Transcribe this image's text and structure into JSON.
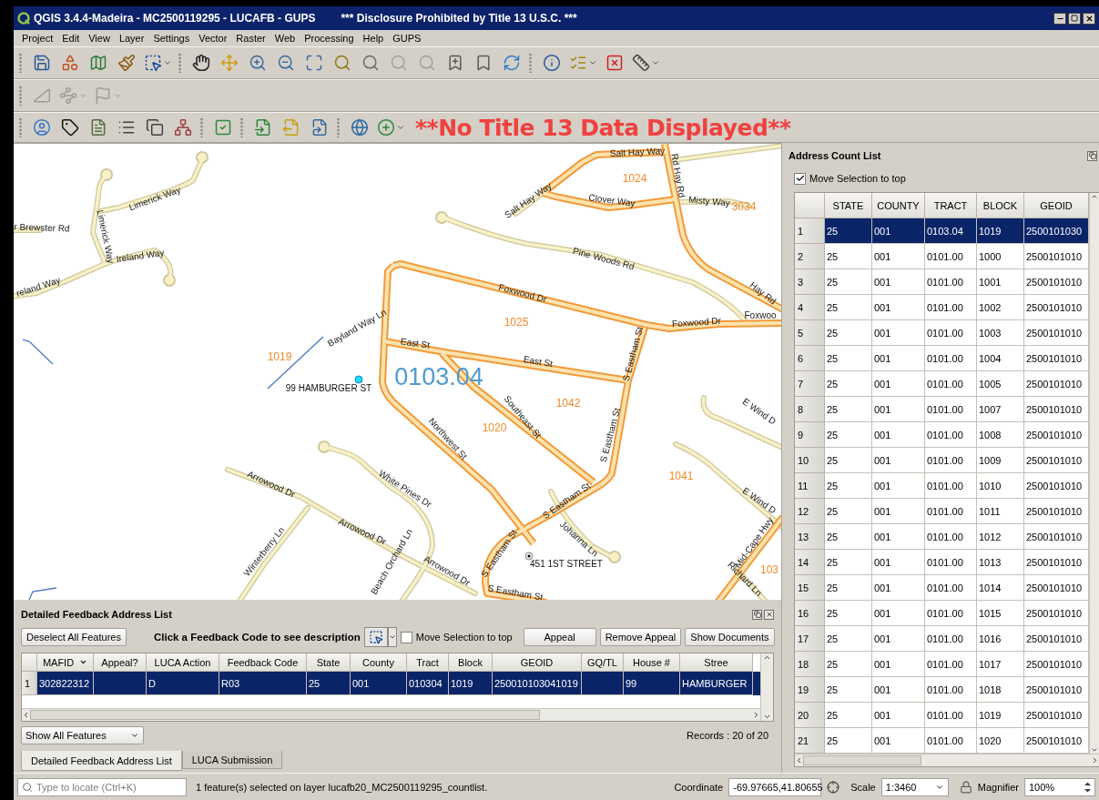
{
  "window": {
    "title": "QGIS 3.4.4-Madeira - MC2500119295 - LUCAFB - GUPS",
    "notice": "*** Disclosure Prohibited by Title 13 U.S.C. ***"
  },
  "menu": [
    "Project",
    "Edit",
    "View",
    "Layer",
    "Settings",
    "Vector",
    "Raster",
    "Web",
    "Processing",
    "Help",
    "GUPS"
  ],
  "banner": "**No Title 13 Data Displayed**",
  "map": {
    "labels": [
      {
        "kind": "street",
        "text": "Limerick Way"
      },
      {
        "kind": "street",
        "text": "Limerick Way"
      },
      {
        "kind": "street",
        "text": "r Brewster Rd"
      },
      {
        "kind": "street",
        "text": "Ireland Way"
      },
      {
        "kind": "street",
        "text": "reland Way"
      },
      {
        "kind": "block",
        "text": "1019"
      },
      {
        "kind": "street",
        "text": "Bayland Way Ln"
      },
      {
        "kind": "address",
        "text": "99 HAMBURGER ST"
      },
      {
        "kind": "tract",
        "text": "0103.04"
      },
      {
        "kind": "street",
        "text": "Salt Hay Way"
      },
      {
        "kind": "street",
        "text": "Rd Hay Rd"
      },
      {
        "kind": "block",
        "text": "1024"
      },
      {
        "kind": "street",
        "text": "Salt Hay Way"
      },
      {
        "kind": "street",
        "text": "Clover Way"
      },
      {
        "kind": "street",
        "text": "Misty Way"
      },
      {
        "kind": "block",
        "text": "3034"
      },
      {
        "kind": "street",
        "text": "Pine Woods Rd"
      },
      {
        "kind": "street",
        "text": "Hay Rd"
      },
      {
        "kind": "street",
        "text": "Foxwood Dr"
      },
      {
        "kind": "block",
        "text": "1025"
      },
      {
        "kind": "street",
        "text": "Foxwood Dr"
      },
      {
        "kind": "street",
        "text": "Foxwoo"
      },
      {
        "kind": "street",
        "text": "East St"
      },
      {
        "kind": "street",
        "text": "East St"
      },
      {
        "kind": "street",
        "text": "S Eastham St"
      },
      {
        "kind": "block",
        "text": "1042"
      },
      {
        "kind": "street",
        "text": "Southeast St"
      },
      {
        "kind": "block",
        "text": "1020"
      },
      {
        "kind": "street",
        "text": "Northwest St"
      },
      {
        "kind": "street",
        "text": "S Eastham St"
      },
      {
        "kind": "street",
        "text": "E Wind D"
      },
      {
        "kind": "block",
        "text": "1041"
      },
      {
        "kind": "street",
        "text": "E Wind D"
      },
      {
        "kind": "street",
        "text": "S Eastham St"
      },
      {
        "kind": "street",
        "text": "Johanna Ln"
      },
      {
        "kind": "address",
        "text": "451 1ST STREET"
      },
      {
        "kind": "street",
        "text": "S Eastham St"
      },
      {
        "kind": "street",
        "text": "S Eastham St"
      },
      {
        "kind": "street",
        "text": "Arrowood Dr"
      },
      {
        "kind": "street",
        "text": "Mid-Cape Hwy"
      },
      {
        "kind": "block",
        "text": "103"
      },
      {
        "kind": "street",
        "text": "Richard Ln"
      },
      {
        "kind": "street",
        "text": "Arrowood Dr"
      },
      {
        "kind": "street",
        "text": "Arrowood Dr"
      },
      {
        "kind": "street",
        "text": "Winterberry Ln"
      },
      {
        "kind": "street",
        "text": "White Pines Dr"
      },
      {
        "kind": "street",
        "text": "Beach Orchard Ln"
      }
    ]
  },
  "feedback_panel": {
    "title": "Detailed Feedback Address List",
    "deselect_button": "Deselect All Features",
    "hint": "Click a Feedback Code to see description",
    "move_selection": {
      "label": "Move Selection to top",
      "checked": false
    },
    "buttons": [
      "Appeal",
      "Remove Appeal",
      "Show Documents"
    ],
    "columns": [
      "MAFID",
      "Appeal?",
      "LUCA Action",
      "Feedback Code",
      "State",
      "County",
      "Tract",
      "Block",
      "GEOID",
      "GQ/TL",
      "House #",
      "Stree"
    ],
    "rows": [
      {
        "number": "1",
        "selected": true,
        "cells": [
          "302822312",
          null,
          "D",
          "R03",
          "25",
          "001",
          "010304",
          "1019",
          "250010103041019",
          null,
          "99",
          "HAMBURGER"
        ]
      }
    ],
    "filter": "Show All Features",
    "records": "Records : 20 of 20"
  },
  "dock_tabs": [
    {
      "label": "Detailed Feedback Address List",
      "selected": true
    },
    {
      "label": "LUCA Submission",
      "selected": false
    }
  ],
  "count_panel": {
    "title": "Address Count List",
    "move_selection": {
      "label": "Move Selection to top",
      "checked": true
    },
    "columns": [
      "STATE",
      "COUNTY",
      "TRACT",
      "BLOCK",
      "GEOID"
    ],
    "rows": [
      {
        "number": "1",
        "selected": true,
        "cells": [
          "25",
          "001",
          "0103.04",
          "1019",
          "2500101030"
        ]
      },
      {
        "number": "2",
        "selected": false,
        "cells": [
          "25",
          "001",
          "0101.00",
          "1000",
          "2500101010"
        ]
      },
      {
        "number": "3",
        "selected": false,
        "cells": [
          "25",
          "001",
          "0101.00",
          "1001",
          "2500101010"
        ]
      },
      {
        "number": "4",
        "selected": false,
        "cells": [
          "25",
          "001",
          "0101.00",
          "1002",
          "2500101010"
        ]
      },
      {
        "number": "5",
        "selected": false,
        "cells": [
          "25",
          "001",
          "0101.00",
          "1003",
          "2500101010"
        ]
      },
      {
        "number": "6",
        "selected": false,
        "cells": [
          "25",
          "001",
          "0101.00",
          "1004",
          "2500101010"
        ]
      },
      {
        "number": "7",
        "selected": false,
        "cells": [
          "25",
          "001",
          "0101.00",
          "1005",
          "2500101010"
        ]
      },
      {
        "number": "8",
        "selected": false,
        "cells": [
          "25",
          "001",
          "0101.00",
          "1007",
          "2500101010"
        ]
      },
      {
        "number": "9",
        "selected": false,
        "cells": [
          "25",
          "001",
          "0101.00",
          "1008",
          "2500101010"
        ]
      },
      {
        "number": "10",
        "selected": false,
        "cells": [
          "25",
          "001",
          "0101.00",
          "1009",
          "2500101010"
        ]
      },
      {
        "number": "11",
        "selected": false,
        "cells": [
          "25",
          "001",
          "0101.00",
          "1010",
          "2500101010"
        ]
      },
      {
        "number": "12",
        "selected": false,
        "cells": [
          "25",
          "001",
          "0101.00",
          "1011",
          "2500101010"
        ]
      },
      {
        "number": "13",
        "selected": false,
        "cells": [
          "25",
          "001",
          "0101.00",
          "1012",
          "2500101010"
        ]
      },
      {
        "number": "14",
        "selected": false,
        "cells": [
          "25",
          "001",
          "0101.00",
          "1013",
          "2500101010"
        ]
      },
      {
        "number": "15",
        "selected": false,
        "cells": [
          "25",
          "001",
          "0101.00",
          "1014",
          "2500101010"
        ]
      },
      {
        "number": "16",
        "selected": false,
        "cells": [
          "25",
          "001",
          "0101.00",
          "1015",
          "2500101010"
        ]
      },
      {
        "number": "17",
        "selected": false,
        "cells": [
          "25",
          "001",
          "0101.00",
          "1016",
          "2500101010"
        ]
      },
      {
        "number": "18",
        "selected": false,
        "cells": [
          "25",
          "001",
          "0101.00",
          "1017",
          "2500101010"
        ]
      },
      {
        "number": "19",
        "selected": false,
        "cells": [
          "25",
          "001",
          "0101.00",
          "1018",
          "2500101010"
        ]
      },
      {
        "number": "20",
        "selected": false,
        "cells": [
          "25",
          "001",
          "0101.00",
          "1019",
          "2500101010"
        ]
      },
      {
        "number": "21",
        "selected": false,
        "cells": [
          "25",
          "001",
          "0101.00",
          "1020",
          "2500101010"
        ]
      }
    ]
  },
  "status_bar": {
    "locator_placeholder": "Type to locate (Ctrl+K)",
    "message": "1 feature(s) selected on layer lucafb20_MC2500119295_countlist.",
    "coordinate_label": "Coordinate",
    "coordinate": "-69.97665,41.80655",
    "scale_label": "Scale",
    "scale": "1:3460",
    "magnifier_label": "Magnifier",
    "magnifier": "100%"
  }
}
